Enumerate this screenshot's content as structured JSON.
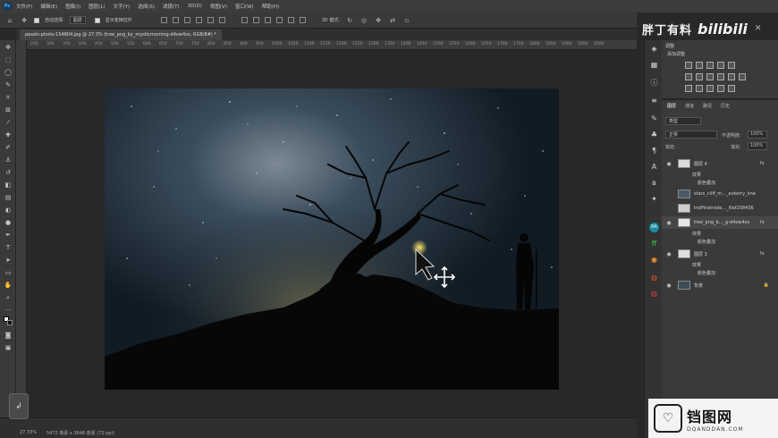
{
  "app": {
    "logo": "Ps"
  },
  "menu": [
    "文件(F)",
    "编辑(E)",
    "图像(I)",
    "图层(L)",
    "文字(Y)",
    "选择(S)",
    "滤镜(T)",
    "3D(D)",
    "视图(V)",
    "窗口(W)",
    "帮助(H)"
  ],
  "options": {
    "autoselect_label": "自动选择:",
    "autoselect_value": "图层",
    "transform_label": "显示变换控件",
    "mode_label": "3D 模式:"
  },
  "watermark": {
    "text": "胖丁有料",
    "brand": "bilibili"
  },
  "document": {
    "tab": "pexels-photo-154804.jpg @ 27.3% (tree_png_by_mysticmorning-d4ow4so, RGB/8#) *"
  },
  "ruler": {
    "ticks": [
      "250",
      "300",
      "350",
      "400",
      "450",
      "500",
      "550",
      "600",
      "650",
      "700",
      "750",
      "800",
      "850",
      "900",
      "950",
      "1000",
      "1050",
      "1100",
      "1150",
      "1200",
      "1250",
      "1300",
      "1350",
      "1400",
      "1450",
      "1500",
      "1550",
      "1600",
      "1650",
      "1700",
      "1750",
      "1800",
      "1850",
      "1900",
      "1950",
      "2000"
    ]
  },
  "status": {
    "zoom": "27.33%",
    "doc": "5472 像素 x 3648 像素 (72 ppi)"
  },
  "panels": {
    "adjustments_tab": "调整",
    "adjustments_title": "添加调整",
    "layers_tabs": [
      "图层",
      "通道",
      "路径",
      "历史"
    ],
    "kind_label": "类型",
    "blend_mode": "正常",
    "opacity_label": "不透明度:",
    "opacity_value": "100%",
    "lock_label": "锁定:",
    "fill_label": "填充:",
    "fill_value": "100%"
  },
  "layers": [
    {
      "name": "图层 4",
      "fx": "fx",
      "effects_label": "效果",
      "effect": "颜色叠加"
    },
    {
      "name": "stars_cliff_m..._avkerry_kne"
    },
    {
      "name": "traffinetrode..._illaf208436"
    },
    {
      "name": "tree_png_b..._g-d4ow4so",
      "fx": "fx",
      "effects_label": "效果",
      "effect": "颜色叠加"
    },
    {
      "name": "图层 3",
      "fx": "fx",
      "effects_label": "效果",
      "effect": "颜色叠加"
    },
    {
      "name": "背景"
    }
  ],
  "bottom_watermark": {
    "name": "铛图网",
    "url": "DQANDDAN.COM"
  },
  "colors": {
    "menu_bg": "#3c3c3c",
    "panel_bg": "#3a3a3a",
    "canvas_bg": "#282828",
    "selection": "#474747"
  }
}
